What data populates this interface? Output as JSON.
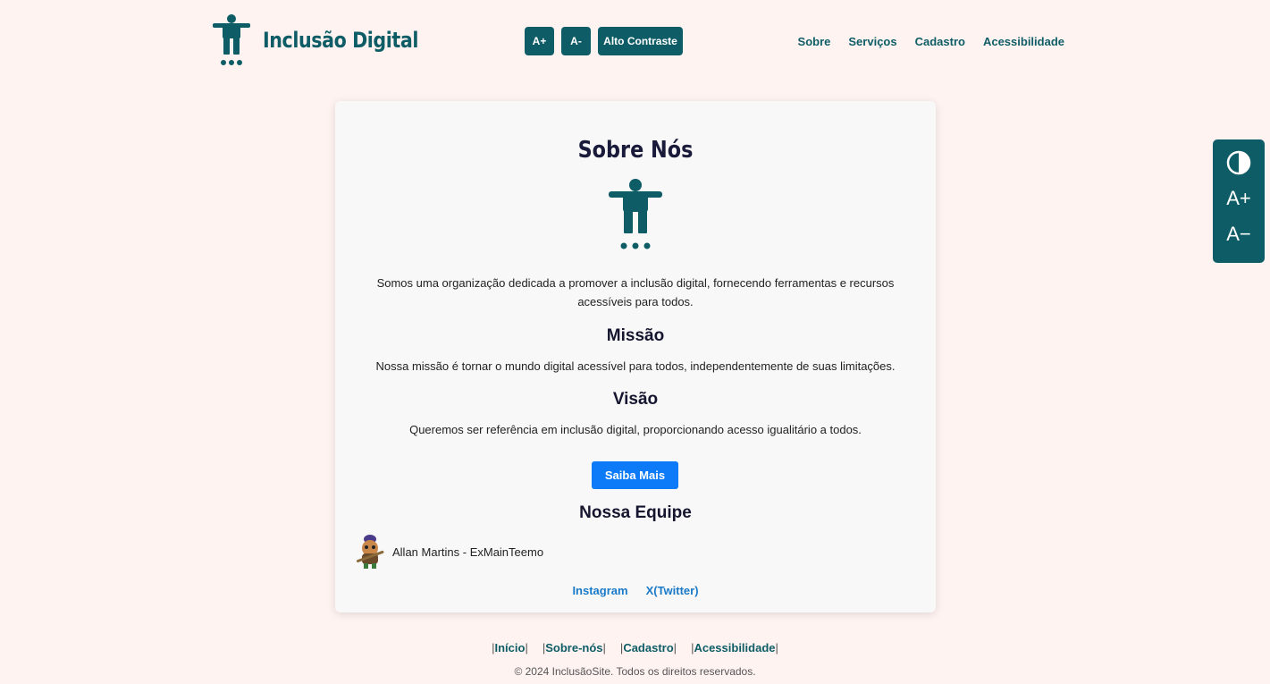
{
  "header": {
    "brand": "Inclusão Digital",
    "font_increase": "A+",
    "font_decrease": "A-",
    "contrast": "Alto Contraste",
    "nav": [
      "Sobre",
      "Serviços",
      "Cadastro",
      "Acessibilidade"
    ]
  },
  "side_panel": {
    "increase": "A+",
    "decrease": "A−"
  },
  "main": {
    "title": "Sobre Nós",
    "intro": "Somos uma organização dedicada a promover a inclusão digital, fornecendo ferramentas e recursos acessíveis para todos.",
    "mission_title": "Missão",
    "mission_text": "Nossa missão é tornar o mundo digital acessível para todos, independentemente de suas limitações.",
    "vision_title": "Visão",
    "vision_text": "Queremos ser referência em inclusão digital, proporcionando acesso igualitário a todos.",
    "cta": "Saiba Mais",
    "team_title": "Nossa Equipe",
    "team_member": "Allan Martins - ExMainTeemo",
    "socials": [
      "Instagram",
      "X(Twitter)"
    ]
  },
  "footer": {
    "links": [
      "Início",
      "Sobre-nós",
      "Cadastro",
      "Acessibilidade"
    ],
    "copyright": "© 2024 InclusãoSite. Todos os direitos reservados."
  },
  "colors": {
    "background": "#fff3f1",
    "brand": "#0e5d66",
    "accent": "#0d7bf7",
    "link": "#1a7ac8"
  },
  "icons": [
    "accessibility-icon",
    "contrast-icon",
    "avatar"
  ]
}
